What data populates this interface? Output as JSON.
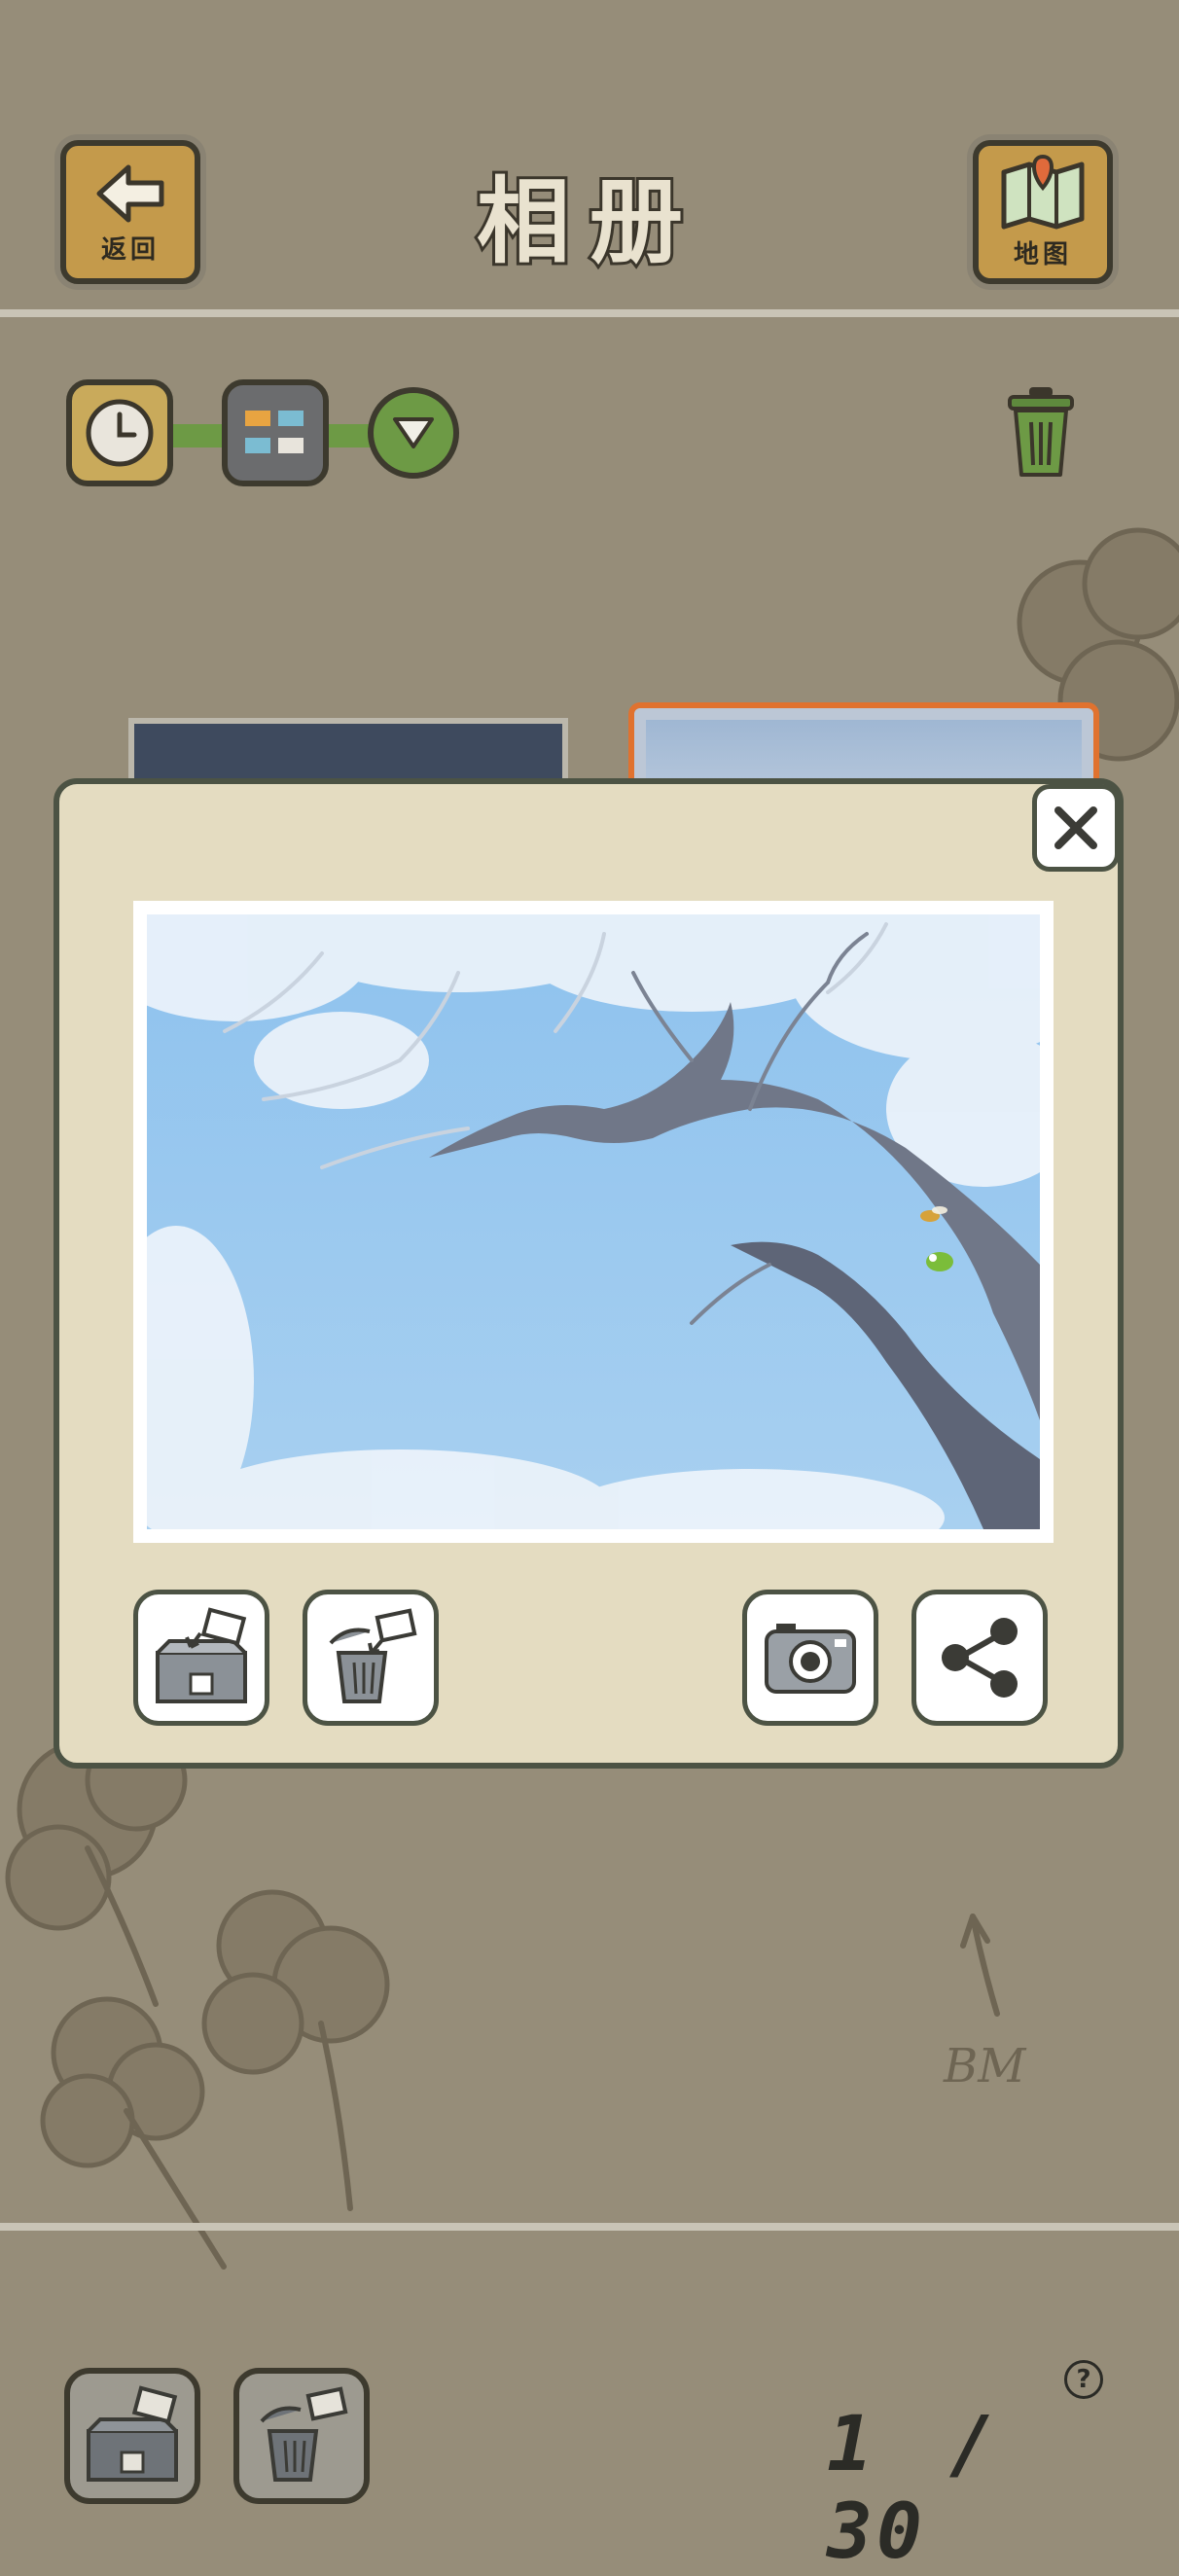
{
  "header": {
    "back_label": "返回",
    "title": "相册",
    "map_label": "地图"
  },
  "toolbar": {
    "sort_icon": "clock-icon",
    "view_icon": "grid-icon",
    "dropdown_icon": "triangle-down-icon",
    "trash_icon": "trash-icon"
  },
  "modal": {
    "close_icon": "close-icon",
    "actions": [
      {
        "id": "store",
        "icon": "box-store-icon"
      },
      {
        "id": "delete",
        "icon": "trash-delete-icon"
      },
      {
        "id": "save",
        "icon": "camera-icon"
      },
      {
        "id": "share",
        "icon": "share-icon"
      }
    ]
  },
  "footer": {
    "counter_current": "1",
    "counter_sep": "/",
    "counter_total": "30",
    "help_label": "?"
  },
  "colors": {
    "background": "#968d79",
    "modal": "#e4dcc1",
    "wood": "#c49a4b",
    "green": "#6d9a45"
  },
  "doodle_signature": "BM"
}
